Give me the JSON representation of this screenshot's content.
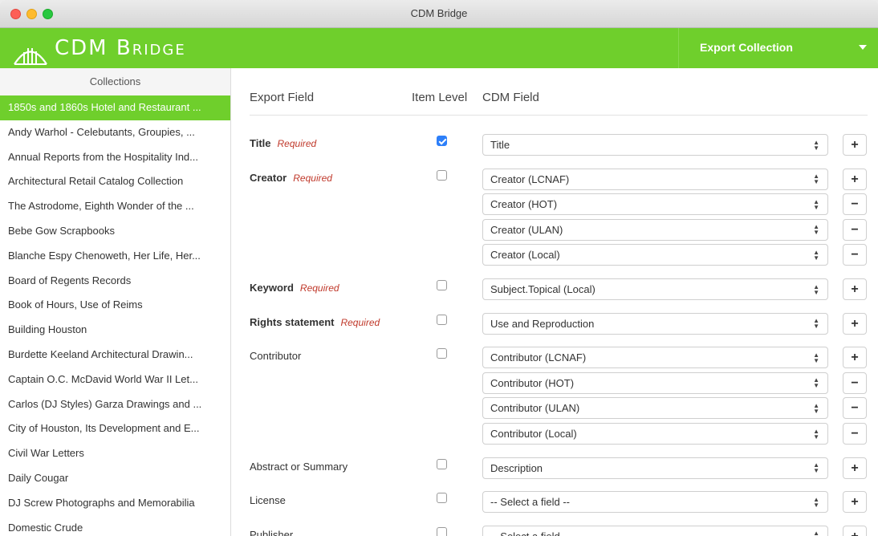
{
  "window": {
    "title": "CDM Bridge"
  },
  "header": {
    "logo_text": "CDM Bridge",
    "export_menu": "Export Collection"
  },
  "sidebar": {
    "title": "Collections",
    "items": [
      "1850s and 1860s Hotel and Restaurant ...",
      "Andy Warhol - Celebutants, Groupies, ...",
      "Annual Reports from the Hospitality Ind...",
      "Architectural Retail Catalog Collection",
      "The Astrodome, Eighth Wonder of the ...",
      "Bebe Gow Scrapbooks",
      "Blanche Espy Chenoweth, Her Life, Her...",
      "Board of Regents Records",
      "Book of Hours, Use of Reims",
      "Building Houston",
      "Burdette Keeland Architectural Drawin...",
      "Captain O.C. McDavid World War II Let...",
      "Carlos (DJ Styles) Garza Drawings and ...",
      "City of Houston, Its Development and E...",
      "Civil War Letters",
      "Daily Cougar",
      "DJ Screw Photographs and Memorabilia",
      "Domestic Crude"
    ],
    "active_index": 0
  },
  "main": {
    "columns": {
      "export_field": "Export Field",
      "item_level": "Item Level",
      "cdm_field": "CDM Field"
    },
    "required_tag": "Required",
    "rows": [
      {
        "label": "Title",
        "required": true,
        "item_level": true,
        "selects": [
          {
            "value": "Title",
            "button": "+"
          }
        ]
      },
      {
        "label": "Creator",
        "required": true,
        "item_level": false,
        "selects": [
          {
            "value": "Creator (LCNAF)",
            "button": "+"
          },
          {
            "value": "Creator (HOT)",
            "button": "−"
          },
          {
            "value": "Creator (ULAN)",
            "button": "−"
          },
          {
            "value": "Creator (Local)",
            "button": "−"
          }
        ]
      },
      {
        "label": "Keyword",
        "required": true,
        "item_level": false,
        "selects": [
          {
            "value": "Subject.Topical (Local)",
            "button": "+"
          }
        ]
      },
      {
        "label": "Rights statement",
        "required": true,
        "item_level": false,
        "selects": [
          {
            "value": "Use and Reproduction",
            "button": "+"
          }
        ]
      },
      {
        "label": "Contributor",
        "required": false,
        "item_level": false,
        "selects": [
          {
            "value": "Contributor (LCNAF)",
            "button": "+"
          },
          {
            "value": "Contributor (HOT)",
            "button": "−"
          },
          {
            "value": "Contributor (ULAN)",
            "button": "−"
          },
          {
            "value": "Contributor (Local)",
            "button": "−"
          }
        ]
      },
      {
        "label": "Abstract or Summary",
        "required": false,
        "item_level": false,
        "selects": [
          {
            "value": "Description",
            "button": "+"
          }
        ]
      },
      {
        "label": "License",
        "required": false,
        "item_level": false,
        "selects": [
          {
            "value": "-- Select a field --",
            "button": "+"
          }
        ]
      },
      {
        "label": "Publisher",
        "required": false,
        "item_level": false,
        "selects": [
          {
            "value": "-- Select a field --",
            "button": "+"
          }
        ]
      }
    ]
  },
  "colors": {
    "brand_green": "#6fcf2c",
    "checkbox_blue": "#2d7ff9",
    "required_red": "#c0392b"
  }
}
